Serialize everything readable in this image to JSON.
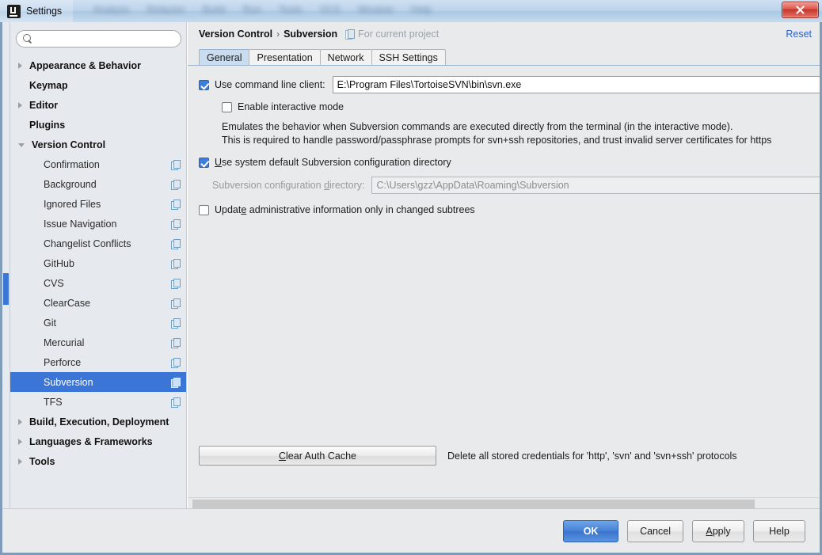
{
  "window": {
    "title": "Settings",
    "logo_icon": "intellij-logo-icon",
    "close_label": "✖",
    "background_menu": [
      "Analyze",
      "Refactor",
      "Build",
      "Run",
      "Tools",
      "VCS",
      "Window",
      "Help"
    ]
  },
  "sidebar": {
    "search": {
      "value": "",
      "placeholder": "",
      "icon": "search-icon"
    },
    "items": [
      {
        "label": "Appearance & Behavior",
        "level": "top",
        "arrow": "right",
        "scoped": false,
        "selected": false
      },
      {
        "label": "Keymap",
        "level": "top",
        "arrow": "none",
        "scoped": false,
        "selected": false
      },
      {
        "label": "Editor",
        "level": "top",
        "arrow": "right",
        "scoped": false,
        "selected": false
      },
      {
        "label": "Plugins",
        "level": "top",
        "arrow": "none",
        "scoped": false,
        "selected": false
      },
      {
        "label": "Version Control",
        "level": "top",
        "arrow": "down",
        "scoped": false,
        "selected": false
      },
      {
        "label": "Confirmation",
        "level": "child",
        "arrow": "none",
        "scoped": true,
        "selected": false
      },
      {
        "label": "Background",
        "level": "child",
        "arrow": "none",
        "scoped": true,
        "selected": false
      },
      {
        "label": "Ignored Files",
        "level": "child",
        "arrow": "none",
        "scoped": true,
        "selected": false
      },
      {
        "label": "Issue Navigation",
        "level": "child",
        "arrow": "none",
        "scoped": true,
        "selected": false
      },
      {
        "label": "Changelist Conflicts",
        "level": "child",
        "arrow": "none",
        "scoped": true,
        "selected": false
      },
      {
        "label": "GitHub",
        "level": "child",
        "arrow": "none",
        "scoped": true,
        "selected": false
      },
      {
        "label": "CVS",
        "level": "child",
        "arrow": "none",
        "scoped": true,
        "selected": false
      },
      {
        "label": "ClearCase",
        "level": "child",
        "arrow": "none",
        "scoped": true,
        "selected": false
      },
      {
        "label": "Git",
        "level": "child",
        "arrow": "none",
        "scoped": true,
        "selected": false
      },
      {
        "label": "Mercurial",
        "level": "child",
        "arrow": "none",
        "scoped": true,
        "selected": false
      },
      {
        "label": "Perforce",
        "level": "child",
        "arrow": "none",
        "scoped": true,
        "selected": false
      },
      {
        "label": "Subversion",
        "level": "child",
        "arrow": "none",
        "scoped": true,
        "selected": true
      },
      {
        "label": "TFS",
        "level": "child",
        "arrow": "none",
        "scoped": true,
        "selected": false
      },
      {
        "label": "Build, Execution, Deployment",
        "level": "top",
        "arrow": "right",
        "scoped": false,
        "selected": false
      },
      {
        "label": "Languages & Frameworks",
        "level": "top",
        "arrow": "right",
        "scoped": false,
        "selected": false
      },
      {
        "label": "Tools",
        "level": "top",
        "arrow": "right",
        "scoped": false,
        "selected": false
      }
    ]
  },
  "breadcrumb": {
    "parent": "Version Control",
    "separator": "›",
    "current": "Subversion",
    "scope_note": "For current project",
    "scope_icon": "project-scope-icon",
    "reset_label": "Reset"
  },
  "tabs": [
    {
      "label": "General",
      "active": true
    },
    {
      "label": "Presentation",
      "active": false
    },
    {
      "label": "Network",
      "active": false
    },
    {
      "label": "SSH Settings",
      "active": false
    }
  ],
  "form": {
    "use_command_line_client": {
      "label": "Use command line client:",
      "checked": true,
      "path_value": "E:\\Program Files\\TortoiseSVN\\bin\\svn.exe"
    },
    "enable_interactive_mode": {
      "label": "Enable interactive mode",
      "checked": false
    },
    "description_lines": [
      "Emulates the behavior when Subversion commands are executed directly from the terminal (in the interactive mode).",
      "This is required to handle password/passphrase prompts for svn+ssh repositories, and trust invalid server certificates for https"
    ],
    "use_system_default_dir": {
      "label_prefix": "U",
      "label_rest": "se system default Subversion configuration directory",
      "checked": true
    },
    "config_directory": {
      "label_pre": "Subversion configuration ",
      "label_mnemonic": "d",
      "label_post": "irectory:",
      "value": "C:\\Users\\gzz\\AppData\\Roaming\\Subversion",
      "enabled": false
    },
    "update_admin_info": {
      "label_pre": "Updat",
      "label_mnemonic": "e",
      "label_post": " administrative information only in changed subtrees",
      "checked": false
    },
    "clear_auth_cache": {
      "label_mnemonic": "C",
      "label_rest": "lear Auth Cache",
      "note": "Delete all stored credentials for 'http', 'svn' and 'svn+ssh' protocols"
    }
  },
  "footer": {
    "ok": "OK",
    "cancel": "Cancel",
    "apply_mnemonic": "A",
    "apply_rest": "pply",
    "help": "Help"
  },
  "colors": {
    "selection": "#3b76d6",
    "primary_button": "#4781d6",
    "link": "#2b62c7",
    "tab_active": "#c9dcf0"
  }
}
